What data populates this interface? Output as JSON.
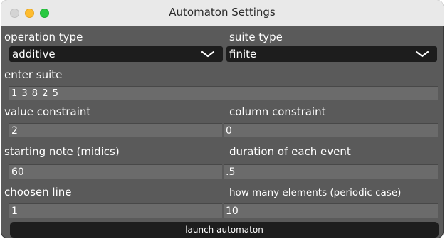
{
  "window": {
    "title": "Automaton Settings"
  },
  "labels": {
    "operation_type": "operation type",
    "suite_type": "suite type",
    "enter_suite": "enter suite",
    "value_constraint": "value constraint",
    "column_constraint": "column constraint",
    "starting_note": "starting note (midics)",
    "duration": "duration of each event",
    "choosen_line": "choosen line",
    "how_many": "how many elements (periodic case)"
  },
  "selects": {
    "operation_type": "additive",
    "suite_type": "finite"
  },
  "values": {
    "suite": "1 3 8 2 5",
    "value_constraint": "2",
    "column_constraint": "0",
    "starting_note": "60",
    "duration": ".5",
    "choosen_line": "1",
    "how_many": "10"
  },
  "buttons": {
    "launch": "launch automaton"
  },
  "colors": {
    "panel": "#5a5a5a",
    "field": "#6b6b6b",
    "select_bg": "#1d1d1d",
    "close": "#d4d4d4",
    "minimize": "#febc2e",
    "maximize": "#28c840"
  },
  "icons": {
    "select_arrow": "chevron-down-icon"
  }
}
